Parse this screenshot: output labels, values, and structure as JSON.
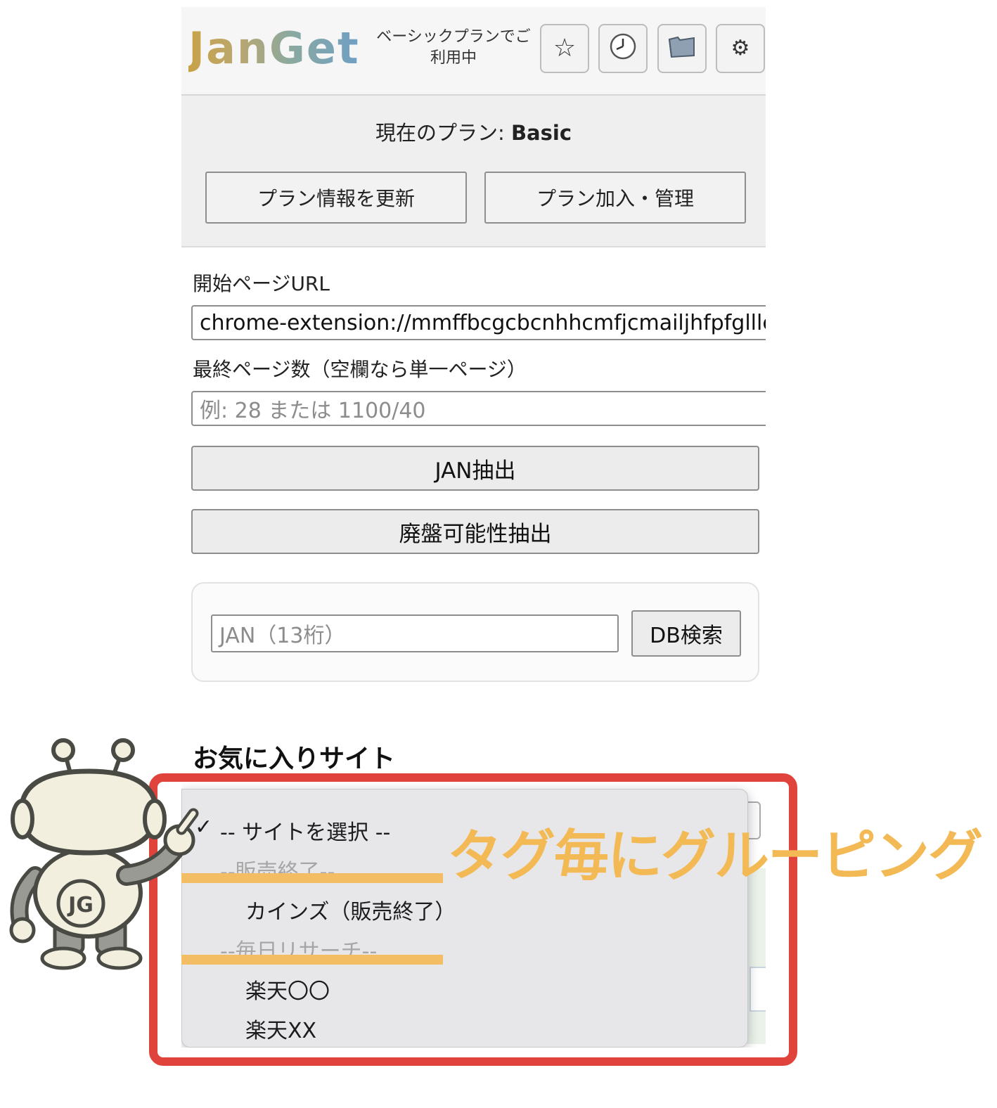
{
  "header": {
    "logo": "JanGet",
    "plan_note_line1": "ベーシックプランでご",
    "plan_note_line2": "利用中",
    "buttons": [
      {
        "icon": "star-icon",
        "glyph": "☆"
      },
      {
        "icon": "clock-icon",
        "glyph": "🕘"
      },
      {
        "icon": "folder-icon",
        "glyph": "📁"
      },
      {
        "icon": "gear-icon",
        "glyph": "⚙"
      }
    ]
  },
  "plan": {
    "label": "現在のプラン: ",
    "value": "Basic",
    "refresh_button": "プラン情報を更新",
    "manage_button": "プラン加入・管理"
  },
  "form": {
    "start_url_label": "開始ページURL",
    "start_url_value": "chrome-extension://mmffbcgcbcnhhcmfjcmailjhfpfglllc",
    "last_page_label": "最終ページ数（空欄なら単一ページ）",
    "last_page_placeholder": "例: 28 または 1100/40",
    "jan_extract_button": "JAN抽出",
    "discontinued_extract_button": "廃盤可能性抽出"
  },
  "db_search": {
    "placeholder": "JAN（13桁）",
    "button": "DB検索"
  },
  "favorites": {
    "title": "お気に入りサイト",
    "dropdown": {
      "selected_check": "✓",
      "options": [
        {
          "label": "-- サイトを選択 --",
          "type": "selected"
        },
        {
          "label": "--販売終了--",
          "type": "group"
        },
        {
          "label": "カインズ（販売終了）",
          "type": "item"
        },
        {
          "label": "--毎日リサーチ--",
          "type": "group"
        },
        {
          "label": "楽天〇〇",
          "type": "item"
        },
        {
          "label": "楽天XX",
          "type": "item"
        }
      ]
    }
  },
  "annotation": {
    "callout": "タグ毎にグルーピング",
    "mascot_badge": "JG",
    "frame_color": "#e0433b",
    "highlight_color": "#f2bd63"
  }
}
